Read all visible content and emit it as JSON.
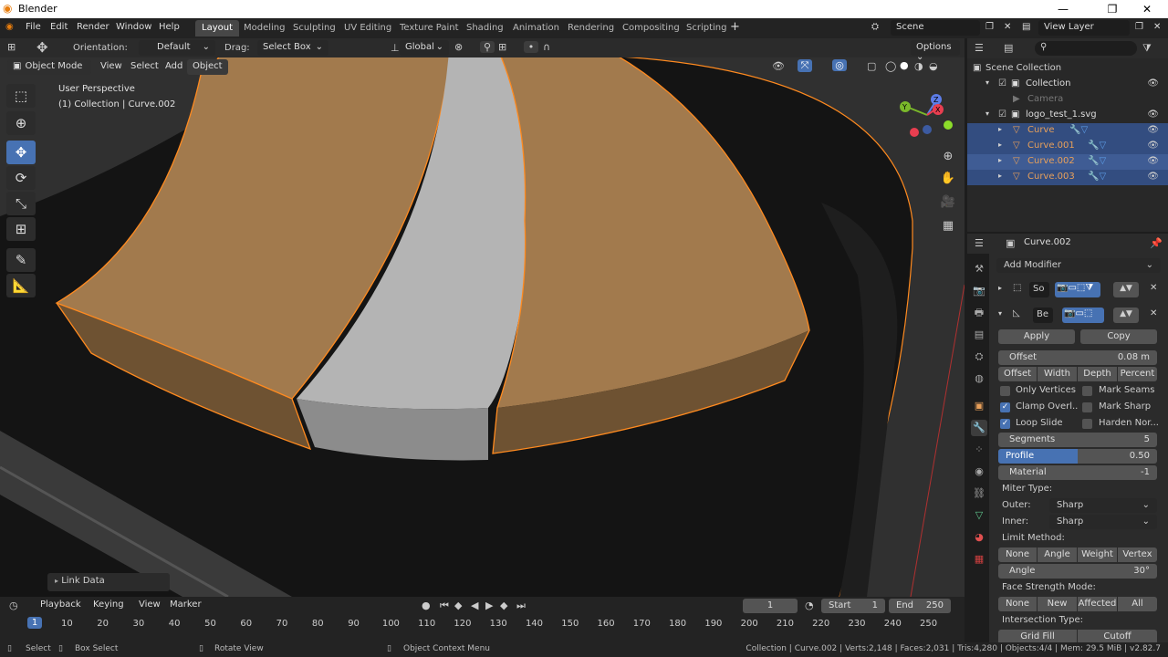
{
  "window": {
    "title": "Blender"
  },
  "menu": [
    "File",
    "Edit",
    "Render",
    "Window",
    "Help"
  ],
  "workspaces": [
    "Layout",
    "Modeling",
    "Sculpting",
    "UV Editing",
    "Texture Paint",
    "Shading",
    "Animation",
    "Rendering",
    "Compositing",
    "Scripting"
  ],
  "active_workspace": "Layout",
  "scene": "Scene",
  "view_layer": "View Layer",
  "tool_header": {
    "orientation_label": "Orientation:",
    "orientation_value": "Default",
    "drag_label": "Drag:",
    "drag_value": "Select Box",
    "transform_orientation": "Global",
    "options": "Options"
  },
  "viewport_header": {
    "mode": "Object Mode",
    "menus": [
      "View",
      "Select",
      "Add",
      "Object"
    ]
  },
  "viewport": {
    "perspective": "User Perspective",
    "context": "(1) Collection | Curve.002",
    "last_op": "Link Data"
  },
  "outliner": {
    "root": "Scene Collection",
    "items": [
      {
        "label": "Collection",
        "level": 1,
        "color": "#dddddd"
      },
      {
        "label": "Camera",
        "level": 2,
        "color": "#777777"
      },
      {
        "label": "logo_test_1.svg",
        "level": 1,
        "color": "#dddddd"
      },
      {
        "label": "Curve",
        "level": 2,
        "color": "#e8a05a"
      },
      {
        "label": "Curve.001",
        "level": 2,
        "color": "#e8a05a"
      },
      {
        "label": "Curve.002",
        "level": 2,
        "color": "#e8a05a"
      },
      {
        "label": "Curve.003",
        "level": 2,
        "color": "#e8a05a"
      }
    ]
  },
  "properties": {
    "object_name": "Curve.002",
    "add_modifier": "Add Modifier",
    "modifier1_name": "So",
    "modifier2_name": "Be",
    "apply": "Apply",
    "copy": "Copy",
    "offset_label": "Offset",
    "offset_value": "0.08 m",
    "offset_modes": [
      "Offset",
      "Width",
      "Depth",
      "Percent"
    ],
    "only_vertices": "Only Vertices",
    "mark_seams": "Mark Seams",
    "clamp_overlap": "Clamp Overl..",
    "mark_sharp": "Mark Sharp",
    "loop_slide": "Loop Slide",
    "harden_normals": "Harden Nor...",
    "segments_label": "Segments",
    "segments_value": "5",
    "profile_label": "Profile",
    "profile_value": "0.50",
    "profile_fraction": 0.5,
    "material_label": "Material",
    "material_value": "-1",
    "miter_type": "Miter Type:",
    "outer_label": "Outer:",
    "outer_value": "Sharp",
    "inner_label": "Inner:",
    "inner_value": "Sharp",
    "limit_method": "Limit Method:",
    "limit_options": [
      "None",
      "Angle",
      "Weight",
      "Vertex ..."
    ],
    "angle_label": "Angle",
    "angle_value": "30°",
    "face_strength": "Face Strength Mode:",
    "face_options": [
      "None",
      "New",
      "Affected",
      "All"
    ],
    "intersection_type": "Intersection Type:",
    "intersection_options": [
      "Grid Fill",
      "Cutoff"
    ]
  },
  "timeline": {
    "menus": [
      "Playback",
      "Keying",
      "View",
      "Marker"
    ],
    "current_frame": "1",
    "start_label": "Start",
    "start": "1",
    "end_label": "End",
    "end": "250",
    "ticks": [
      "1",
      "10",
      "20",
      "30",
      "40",
      "50",
      "60",
      "70",
      "80",
      "90",
      "100",
      "110",
      "120",
      "130",
      "140",
      "150",
      "160",
      "170",
      "180",
      "190",
      "200",
      "210",
      "220",
      "230",
      "240",
      "250"
    ]
  },
  "statusbar": {
    "select": "Select",
    "box_select": "Box Select",
    "rotate_view": "Rotate View",
    "context_menu": "Object Context Menu",
    "stats": "Collection | Curve.002 | Verts:2,148 | Faces:2,031 | Tris:4,280 | Objects:4/4 | Mem: 29.5 MiB | v2.82.7"
  },
  "colors": {
    "accent": "#4772b3",
    "selection": "#ff8a1f",
    "orange_mesh": "#9e7448",
    "grey_mesh": "#a8a8a8"
  }
}
